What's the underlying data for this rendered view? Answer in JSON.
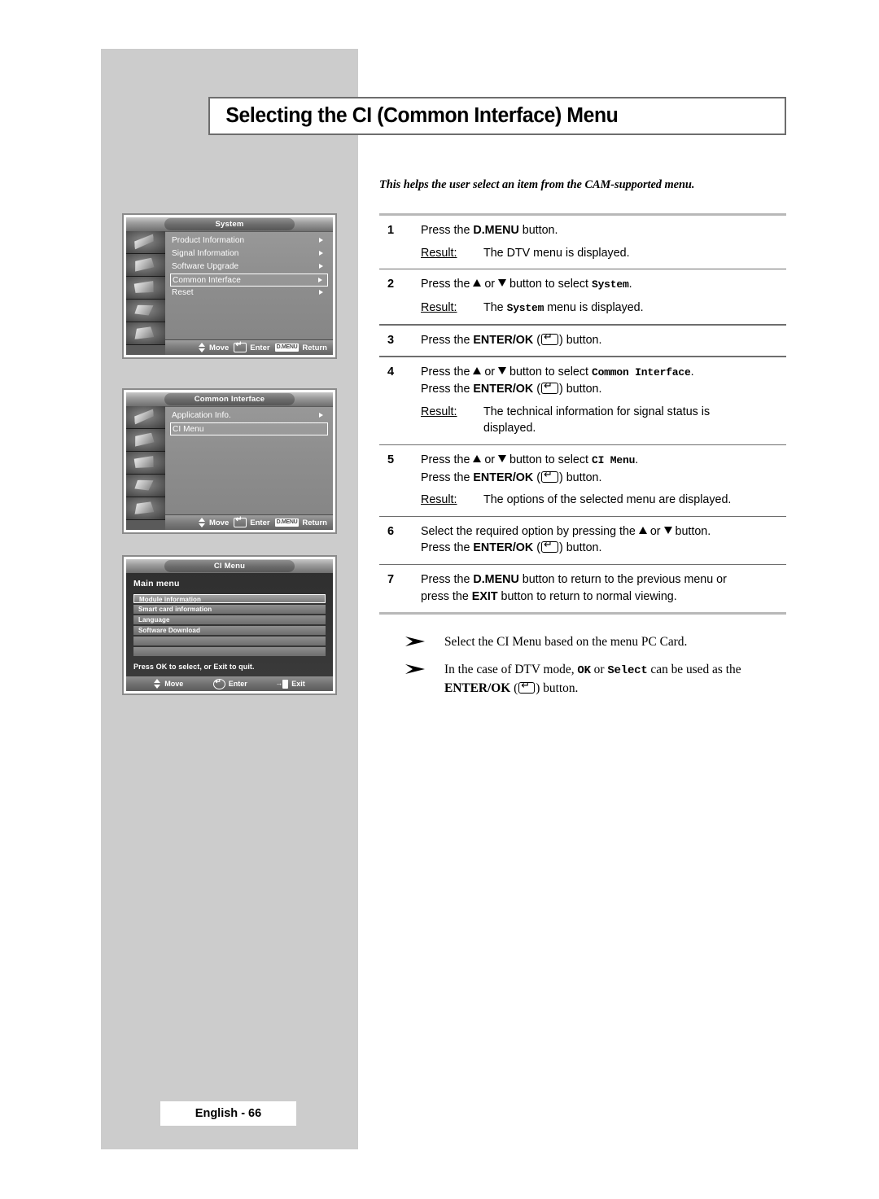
{
  "page": {
    "title": "Selecting the CI (Common Interface) Menu",
    "subtitle": "This helps the user select an item from the CAM-supported menu.",
    "footer_tag": "English - 66"
  },
  "menus": [
    {
      "title": "System",
      "items": [
        {
          "label": "Product Information",
          "arrow": true,
          "selected": false
        },
        {
          "label": "Signal Information",
          "arrow": true,
          "selected": false
        },
        {
          "label": "Software Upgrade",
          "arrow": true,
          "selected": false
        },
        {
          "label": "Common Interface",
          "arrow": true,
          "selected": true
        },
        {
          "label": "Reset",
          "arrow": true,
          "selected": false
        }
      ],
      "footer": [
        {
          "icon": "updown-arrows-icon",
          "label": "Move"
        },
        {
          "icon": "enter-key-icon",
          "label": "Enter"
        },
        {
          "icon": "dmenu-badge-icon",
          "label": "Return",
          "badge": "D.MENU"
        }
      ]
    },
    {
      "title": "Common Interface",
      "items": [
        {
          "label": "Application Info.",
          "arrow": true,
          "selected": false
        },
        {
          "label": "CI Menu",
          "arrow": false,
          "selected": true
        }
      ],
      "footer": [
        {
          "icon": "updown-arrows-icon",
          "label": "Move"
        },
        {
          "icon": "enter-key-icon",
          "label": "Enter"
        },
        {
          "icon": "dmenu-badge-icon",
          "label": "Return",
          "badge": "D.MENU"
        }
      ]
    },
    {
      "title": "CI Menu",
      "heading": "Main menu",
      "items": [
        {
          "label": "Module information",
          "selected": true
        },
        {
          "label": "Smart card information",
          "selected": false
        },
        {
          "label": "Language",
          "selected": false
        },
        {
          "label": "Software Download",
          "selected": false
        },
        {
          "label": "",
          "selected": false
        },
        {
          "label": "",
          "selected": false
        }
      ],
      "note": "Press OK to select, or Exit to quit.",
      "footer": [
        {
          "icon": "updown-arrows-icon",
          "label": "Move"
        },
        {
          "icon": "enter-round-icon",
          "label": "Enter"
        },
        {
          "icon": "exit-door-icon",
          "label": "Exit"
        }
      ]
    }
  ],
  "steps": [
    {
      "num": "1",
      "text_pre": "Press the ",
      "bold": "D.MENU",
      "text_post": " button.",
      "result_label": "Result:",
      "result_pre": "The DTV menu is displayed.",
      "result_mono": "",
      "result_post": ""
    },
    {
      "num": "2",
      "text_pre": "Press the ",
      "mid": " or ",
      "text_post": " button to select ",
      "mono": "System",
      "tail": ".",
      "result_label": "Result:",
      "result_pre": "The ",
      "result_mono": "System",
      "result_post": " menu is displayed."
    },
    {
      "num": "3",
      "text_pre": "Press the ",
      "bold": "ENTER/OK",
      "text_post": " (",
      "tail": ") button."
    },
    {
      "num": "4",
      "line1_pre": "Press the ",
      "line1_mid": " or ",
      "line1_post": " button to select ",
      "line1_mono": "Common Interface",
      "line1_tail": ".",
      "line2_pre": "Press the ",
      "line2_bold": "ENTER/OK",
      "line2_post": " (",
      "line2_tail": ") button.",
      "result_label": "Result:",
      "result_text": "The technical information for signal status is displayed."
    },
    {
      "num": "5",
      "line1_pre": "Press the ",
      "line1_mid": " or ",
      "line1_post": " button to select ",
      "line1_mono": "CI Menu",
      "line1_tail": ".",
      "line2_pre": "Press the ",
      "line2_bold": "ENTER/OK",
      "line2_post": " (",
      "line2_tail": ") button.",
      "result_label": "Result:",
      "result_text": "The options of the selected menu are displayed."
    },
    {
      "num": "6",
      "line1_pre": "Select the required option by pressing the ",
      "line1_mid": " or ",
      "line1_post": " button.",
      "line2_pre": "Press the ",
      "line2_bold": "ENTER/OK",
      "line2_post": " (",
      "line2_tail": ") button."
    },
    {
      "num": "7",
      "line1_pre": "Press the ",
      "line1_bold": "D.MENU",
      "line1_post": " button to return to the previous menu or",
      "line2_pre": "press the ",
      "line2_bold": "EXIT",
      "line2_post": " button to return to normal viewing."
    }
  ],
  "notes": [
    {
      "text": "Select the CI Menu based on the menu PC Card."
    },
    {
      "pre": "In the case of DTV mode, ",
      "mono1": "OK",
      "mid": " or ",
      "mono2": "Select",
      "post": " can be used as the ",
      "bold": "ENTER/OK",
      "tail_pre": " (",
      "tail": ") button."
    }
  ]
}
